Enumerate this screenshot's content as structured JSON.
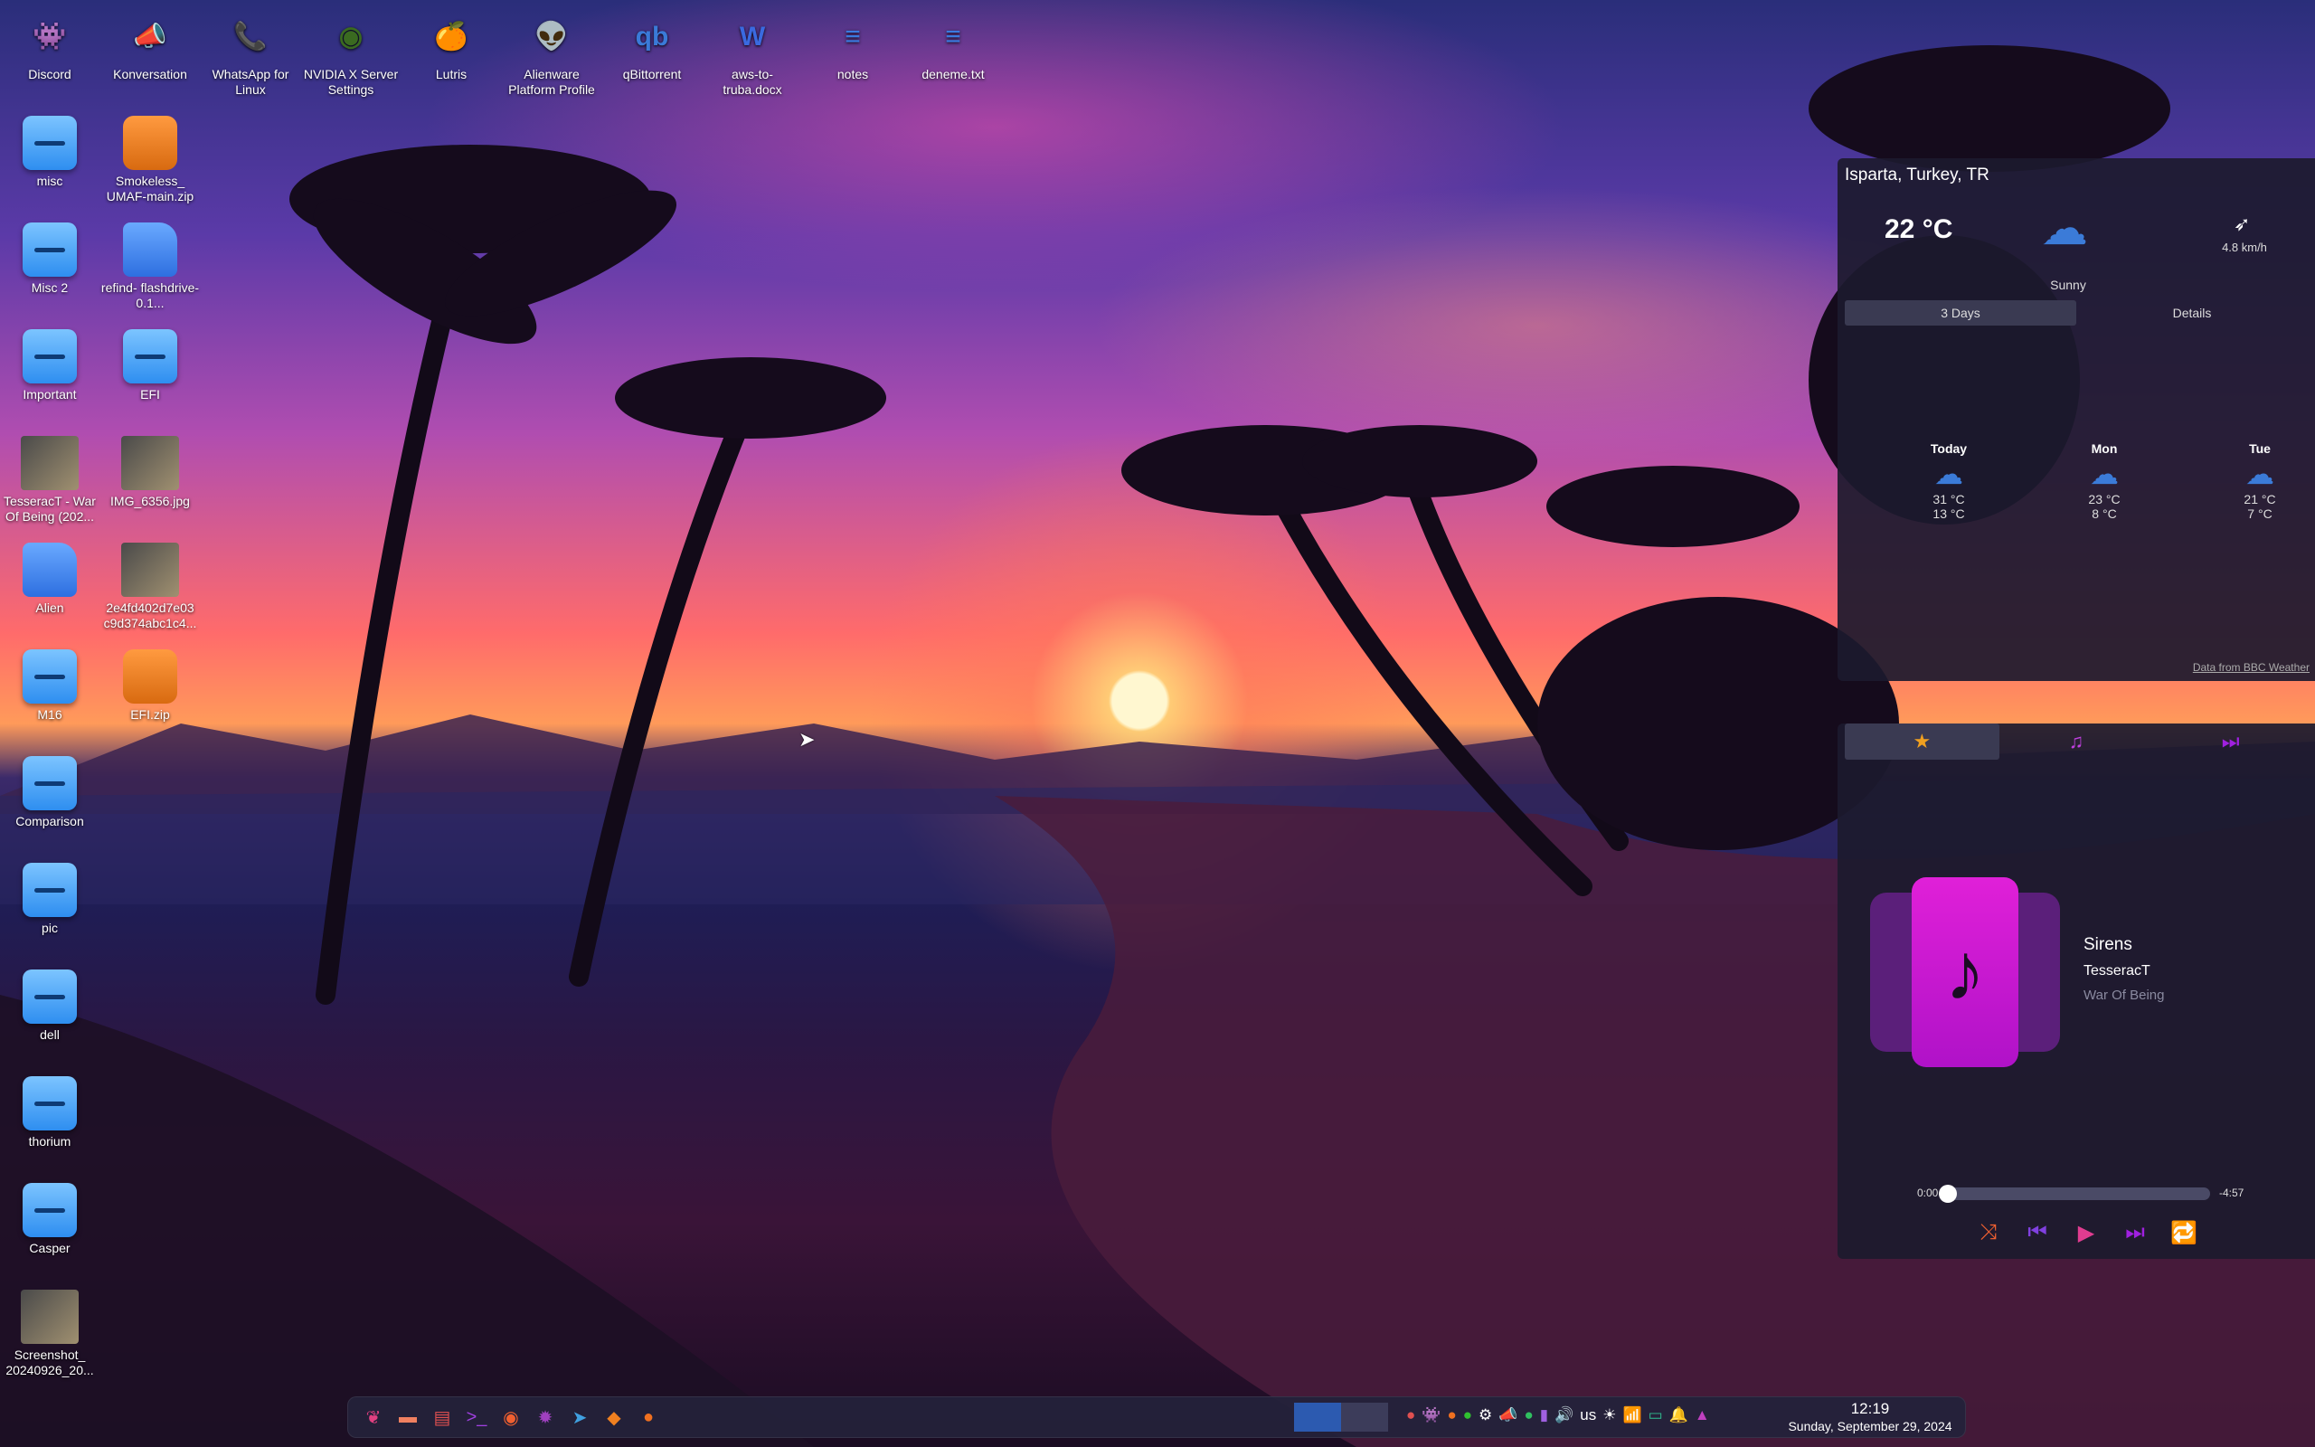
{
  "desktop": {
    "top_icons": [
      {
        "name": "discord-icon",
        "label": "Discord",
        "glyph": "👾",
        "color": "#6b6ef0"
      },
      {
        "name": "konversation-icon",
        "label": "Konversation",
        "glyph": "📣",
        "color": "#3a8de0"
      },
      {
        "name": "whatsapp-icon",
        "label": "WhatsApp for Linux",
        "glyph": "📞",
        "color": "#30c060"
      },
      {
        "name": "nvidia-icon",
        "label": "NVIDIA X Server Settings",
        "glyph": "◉",
        "color": "#3a6a20"
      },
      {
        "name": "lutris-icon",
        "label": "Lutris",
        "glyph": "🍊",
        "color": "#f07020"
      },
      {
        "name": "alienware-icon",
        "label": "Alienware Platform Profile",
        "glyph": "👽",
        "color": "#30c030"
      },
      {
        "name": "qbittorrent-icon",
        "label": "qBittorrent",
        "glyph": "qb",
        "color": "#3a7ad8"
      },
      {
        "name": "word-doc-icon",
        "label": "aws-to-truba.docx",
        "glyph": "W",
        "color": "#3a6ae0"
      },
      {
        "name": "text-file-icon",
        "label": "notes",
        "glyph": "≡",
        "color": "#3a7ae0"
      },
      {
        "name": "text-file-icon",
        "label": "deneme.txt",
        "glyph": "≡",
        "color": "#3a7ae0"
      }
    ],
    "left_icons": [
      {
        "label": "misc",
        "type": "folder"
      },
      {
        "label": "Misc 2",
        "type": "folder"
      },
      {
        "label": "Important",
        "type": "folder"
      },
      {
        "label": "TesseracT - War Of Being (202...",
        "type": "img"
      },
      {
        "label": "Alien",
        "type": "doc"
      },
      {
        "label": "M16",
        "type": "folder"
      },
      {
        "label": "Comparison",
        "type": "folder"
      },
      {
        "label": "pic",
        "type": "folder"
      },
      {
        "label": "dell",
        "type": "folder"
      },
      {
        "label": "thorium",
        "type": "folder"
      },
      {
        "label": "Casper",
        "type": "folder"
      },
      {
        "label": "Screenshot_ 20240926_20...",
        "type": "img"
      }
    ],
    "second_col_icons": [
      {
        "label": "Smokeless_ UMAF-main.zip",
        "type": "zip"
      },
      {
        "label": "refind- flashdrive-0.1...",
        "type": "doc"
      },
      {
        "label": "EFI",
        "type": "folder"
      },
      {
        "label": "IMG_6356.jpg",
        "type": "img"
      },
      {
        "label": "2e4fd402d7e03 c9d374abc1c4...",
        "type": "img"
      },
      {
        "label": "EFI.zip",
        "type": "zip"
      }
    ]
  },
  "weather": {
    "location": "Isparta, Turkey, TR",
    "temperature": "22 °C",
    "condition": "Sunny",
    "wind": "4.8 km/h",
    "tabs": [
      "3 Days",
      "Details"
    ],
    "days": [
      {
        "name": "Today",
        "high": "31 °C",
        "low": "13 °C"
      },
      {
        "name": "Mon",
        "high": "23 °C",
        "low": "8 °C"
      },
      {
        "name": "Tue",
        "high": "21 °C",
        "low": "7 °C"
      }
    ],
    "credit": "Data from BBC Weather",
    "icon_color": "#3b7bd8"
  },
  "media": {
    "title": "Sirens",
    "artist": "TesseracT",
    "album": "War Of Being",
    "elapsed": "0:00",
    "remaining": "-4:57",
    "progress": 0.0,
    "accent": "#c020d0"
  },
  "taskbar": {
    "apps": [
      "kde-launcher-icon",
      "file-manager-icon",
      "archive-icon",
      "terminal-icon",
      "firefox-icon",
      "settings-icon",
      "telegram-icon",
      "brave-icon",
      "lutris-icon"
    ],
    "keyboard_layout": "us",
    "time": "12:19",
    "date": "Sunday, September 29, 2024"
  }
}
